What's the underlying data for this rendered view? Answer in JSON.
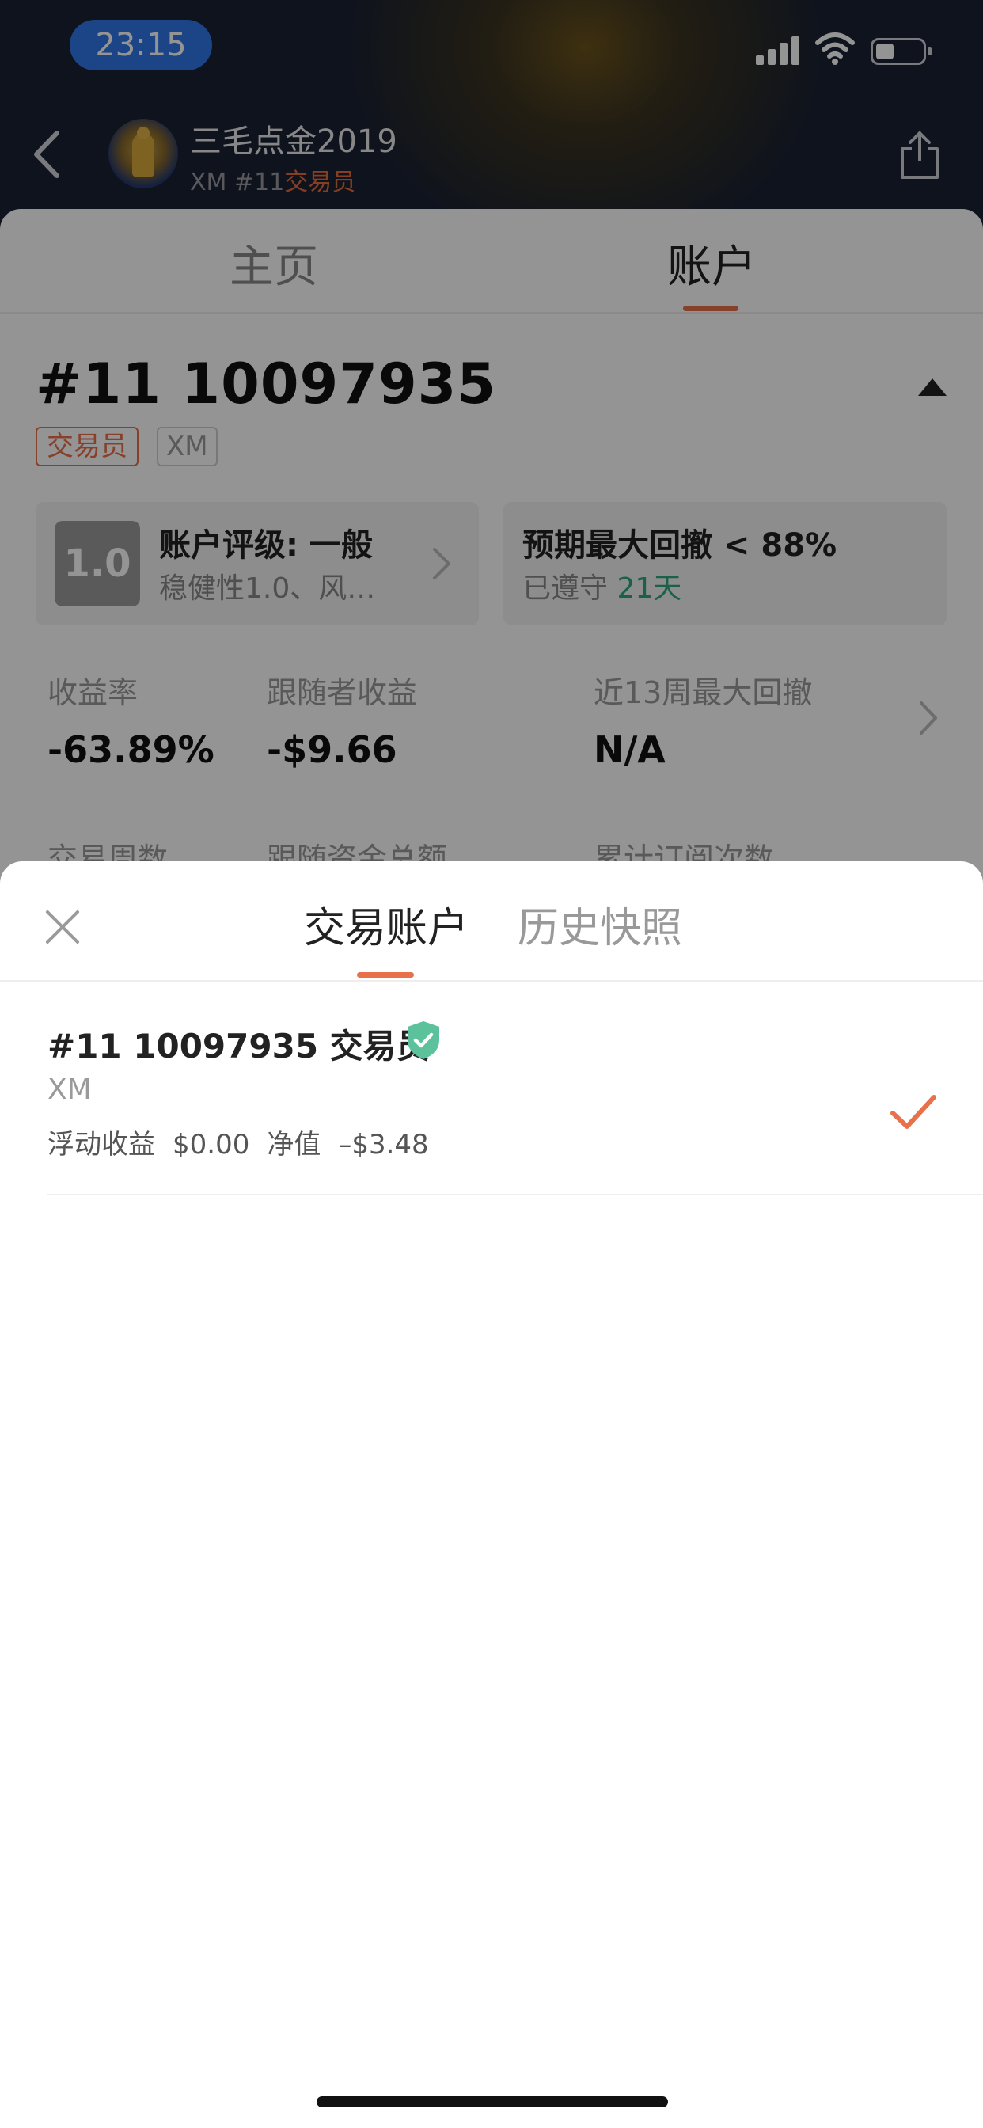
{
  "status_bar": {
    "time": "23:15"
  },
  "header": {
    "trader_name": "三毛点金2019",
    "broker": "XM",
    "rank": "#11",
    "role": "交易员"
  },
  "tabs": {
    "home": "主页",
    "account": "账户"
  },
  "account": {
    "title": "#11 10097935",
    "badge_role": "交易员",
    "badge_broker": "XM",
    "rating": {
      "score": "1.0",
      "title": "账户评级: 一般",
      "subtitle": "稳健性1.0、风…"
    },
    "drawdown": {
      "title": "预期最大回撤 < 88%",
      "kept_label": "已遵守",
      "days": "21天"
    },
    "stats": [
      {
        "label": "收益率",
        "value": "-63.89%"
      },
      {
        "label": "跟随者收益",
        "value": "-$9.66"
      },
      {
        "label": "近13周最大回撤",
        "value": "N/A"
      }
    ],
    "stats_row2": [
      "交易周数",
      "跟随资金总额",
      "累计订阅次数"
    ]
  },
  "sheet": {
    "tabs": {
      "accounts": "交易账户",
      "history": "历史快照"
    },
    "items": [
      {
        "title": "#11 10097935 交易员",
        "broker": "XM",
        "floating_label": "浮动收益",
        "floating_value": "$0.00",
        "equity_label": "净值",
        "equity_value": "–$3.48",
        "selected": true
      }
    ]
  },
  "colors": {
    "accent": "#e8704a",
    "verified": "#5cc29b",
    "days_green": "#2fa57f",
    "time_pill": "#2f78e8"
  }
}
